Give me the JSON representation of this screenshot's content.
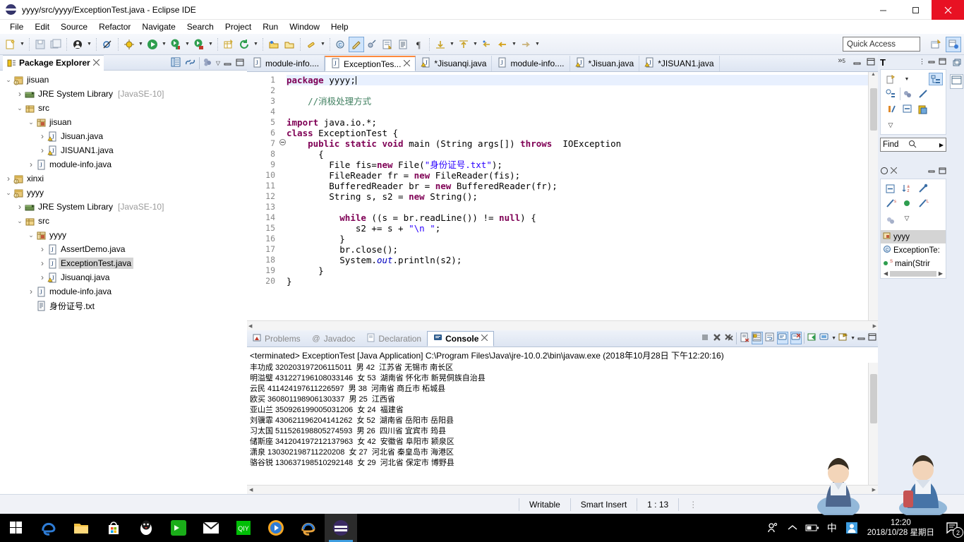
{
  "window": {
    "title": "yyyy/src/yyyy/ExceptionTest.java - Eclipse IDE",
    "app_icon": "eclipse-icon",
    "minimize": "minimize-icon",
    "maximize": "maximize-icon",
    "close": "close-icon"
  },
  "menu": [
    "File",
    "Edit",
    "Source",
    "Refactor",
    "Navigate",
    "Search",
    "Project",
    "Run",
    "Window",
    "Help"
  ],
  "toolbar": {
    "quick_access_placeholder": "Quick Access",
    "icons": [
      "new-wizard-icon",
      "save-icon",
      "save-all-icon",
      "profile-icon",
      "skip-breakpoints-icon",
      "debug-icon",
      "run-icon",
      "coverage-icon",
      "run-external-icon",
      "new-java-package-icon",
      "refresh-icon",
      "open-type-icon",
      "open-task-icon",
      "search-icon",
      "new-class-icon",
      "edit-icon",
      "annotate-icon",
      "open-editor-icon",
      "show-whitespace-icon",
      "pilcrow-icon",
      "next-annotation-icon",
      "previous-annotation-icon",
      "last-edit-icon",
      "back-icon",
      "forward-icon"
    ],
    "perspective_icons": [
      "open-perspective-icon",
      "java-perspective-icon"
    ]
  },
  "package_explorer": {
    "title": "Package Explorer",
    "close_icon": "close-view-icon",
    "toolbar_icons": [
      "collapse-all-icon",
      "link-with-editor-icon",
      "focus-on-active-task-icon",
      "view-menu-icon",
      "minimize-icon",
      "maximize-icon"
    ],
    "tree": [
      {
        "label": "jisuan",
        "indent": 0,
        "icon": "java-project-icon",
        "twisty": "open",
        "dim": false
      },
      {
        "label": "JRE System Library",
        "suffix": "[JavaSE-10]",
        "indent": 1,
        "icon": "library-icon",
        "twisty": "closed",
        "dim": false
      },
      {
        "label": "src",
        "indent": 1,
        "icon": "source-folder-icon",
        "twisty": "open",
        "dim": false
      },
      {
        "label": "jisuan",
        "indent": 2,
        "icon": "package-icon",
        "twisty": "open",
        "dim": false
      },
      {
        "label": "Jisuan.java",
        "indent": 3,
        "icon": "java-file-warning-icon",
        "twisty": "closed",
        "dim": false
      },
      {
        "label": "JISUAN1.java",
        "indent": 3,
        "icon": "java-file-warning-icon",
        "twisty": "closed",
        "dim": false
      },
      {
        "label": "module-info.java",
        "indent": 2,
        "icon": "java-file-icon",
        "twisty": "closed",
        "dim": false
      },
      {
        "label": "xinxi",
        "indent": 0,
        "icon": "java-project-icon",
        "twisty": "closed",
        "dim": false
      },
      {
        "label": "yyyy",
        "indent": 0,
        "icon": "java-project-icon",
        "twisty": "open",
        "dim": false
      },
      {
        "label": "JRE System Library",
        "suffix": "[JavaSE-10]",
        "indent": 1,
        "icon": "library-icon",
        "twisty": "closed",
        "dim": false
      },
      {
        "label": "src",
        "indent": 1,
        "icon": "source-folder-icon",
        "twisty": "open",
        "dim": false
      },
      {
        "label": "yyyy",
        "indent": 2,
        "icon": "package-icon",
        "twisty": "open",
        "dim": false
      },
      {
        "label": "AssertDemo.java",
        "indent": 3,
        "icon": "java-file-icon",
        "twisty": "closed",
        "dim": false
      },
      {
        "label": "ExceptionTest.java",
        "indent": 3,
        "icon": "java-file-icon",
        "twisty": "closed",
        "dim": false,
        "selected": true
      },
      {
        "label": "Jisuanqi.java",
        "indent": 3,
        "icon": "java-file-warning-icon",
        "twisty": "closed",
        "dim": false
      },
      {
        "label": "module-info.java",
        "indent": 2,
        "icon": "java-file-icon",
        "twisty": "closed",
        "dim": false
      },
      {
        "label": "身份证号.txt",
        "indent": 2,
        "icon": "text-file-icon",
        "twisty": "none",
        "dim": false
      }
    ]
  },
  "editor": {
    "tabs": [
      {
        "label": "module-info....",
        "active": false,
        "dirty": false,
        "icon": "java-file-icon"
      },
      {
        "label": "ExceptionTes...",
        "active": true,
        "dirty": false,
        "icon": "java-file-icon"
      },
      {
        "label": "*Jisuanqi.java",
        "active": false,
        "dirty": true,
        "icon": "java-file-warning-icon"
      },
      {
        "label": "module-info....",
        "active": false,
        "dirty": false,
        "icon": "java-file-icon"
      },
      {
        "label": "*Jisuan.java",
        "active": false,
        "dirty": true,
        "icon": "java-file-warning-icon"
      },
      {
        "label": "*JISUAN1.java",
        "active": false,
        "dirty": true,
        "icon": "java-file-warning-icon"
      }
    ],
    "more_tabs": "»",
    "more_tabs_count": "5",
    "lines": [
      {
        "n": 1,
        "fold": "",
        "highlight": true,
        "tokens": [
          {
            "t": "package ",
            "c": "kw"
          },
          {
            "t": "yyyy",
            "c": ""
          },
          {
            "t": ";",
            "c": ""
          },
          {
            "t": "|",
            "c": "cursor"
          }
        ]
      },
      {
        "n": 2,
        "fold": "",
        "tokens": []
      },
      {
        "n": 3,
        "fold": "",
        "tokens": [
          {
            "t": "    //消极处理方式",
            "c": "cmt"
          }
        ]
      },
      {
        "n": 4,
        "fold": "",
        "tokens": []
      },
      {
        "n": 5,
        "fold": "",
        "tokens": [
          {
            "t": "import ",
            "c": "kw"
          },
          {
            "t": "java.io.*;",
            "c": ""
          }
        ]
      },
      {
        "n": 6,
        "fold": "",
        "tokens": [
          {
            "t": "class ",
            "c": "kw"
          },
          {
            "t": "ExceptionTest {",
            "c": ""
          }
        ]
      },
      {
        "n": 7,
        "fold": "collapse",
        "tokens": [
          {
            "t": "    ",
            "c": ""
          },
          {
            "t": "public static void ",
            "c": "kw"
          },
          {
            "t": "main (String args[]) ",
            "c": ""
          },
          {
            "t": "throws ",
            "c": "kw"
          },
          {
            "t": " IOException",
            "c": ""
          }
        ]
      },
      {
        "n": 8,
        "fold": "",
        "tokens": [
          {
            "t": "      {",
            "c": ""
          }
        ]
      },
      {
        "n": 9,
        "fold": "",
        "tokens": [
          {
            "t": "        File fis=",
            "c": ""
          },
          {
            "t": "new ",
            "c": "kw"
          },
          {
            "t": "File(",
            "c": ""
          },
          {
            "t": "\"身份证号.txt\"",
            "c": "str"
          },
          {
            "t": ");",
            "c": ""
          }
        ]
      },
      {
        "n": 10,
        "fold": "",
        "tokens": [
          {
            "t": "        FileReader fr = ",
            "c": ""
          },
          {
            "t": "new ",
            "c": "kw"
          },
          {
            "t": "FileReader(fis);",
            "c": ""
          }
        ]
      },
      {
        "n": 11,
        "fold": "",
        "tokens": [
          {
            "t": "        BufferedReader br = ",
            "c": ""
          },
          {
            "t": "new ",
            "c": "kw"
          },
          {
            "t": "BufferedReader(fr);",
            "c": ""
          }
        ]
      },
      {
        "n": 12,
        "fold": "",
        "tokens": [
          {
            "t": "        String s, s2 = ",
            "c": ""
          },
          {
            "t": "new ",
            "c": "kw"
          },
          {
            "t": "String();",
            "c": ""
          }
        ]
      },
      {
        "n": 13,
        "fold": "",
        "tokens": []
      },
      {
        "n": 14,
        "fold": "",
        "tokens": [
          {
            "t": "          ",
            "c": ""
          },
          {
            "t": "while ",
            "c": "kw"
          },
          {
            "t": "((s = br.readLine()) != ",
            "c": ""
          },
          {
            "t": "null",
            "c": "kw"
          },
          {
            "t": ") {",
            "c": ""
          }
        ]
      },
      {
        "n": 15,
        "fold": "",
        "tokens": [
          {
            "t": "             s2 += s + ",
            "c": ""
          },
          {
            "t": "\"\\n \"",
            "c": "str"
          },
          {
            "t": ";",
            "c": ""
          }
        ]
      },
      {
        "n": 16,
        "fold": "",
        "tokens": [
          {
            "t": "          }",
            "c": ""
          }
        ]
      },
      {
        "n": 17,
        "fold": "",
        "tokens": [
          {
            "t": "          br.close();",
            "c": ""
          }
        ]
      },
      {
        "n": 18,
        "fold": "",
        "tokens": [
          {
            "t": "          System.",
            "c": ""
          },
          {
            "t": "out",
            "c": "fld"
          },
          {
            "t": ".println(s2);",
            "c": ""
          }
        ]
      },
      {
        "n": 19,
        "fold": "",
        "tokens": [
          {
            "t": "      }",
            "c": ""
          }
        ]
      },
      {
        "n": 20,
        "fold": "",
        "tokens": [
          {
            "t": "}",
            "c": ""
          }
        ]
      }
    ]
  },
  "bottom_panel": {
    "tabs": [
      {
        "label": "Problems",
        "icon": "problems-icon",
        "active": false
      },
      {
        "label": "Javadoc",
        "icon": "javadoc-icon",
        "active": false
      },
      {
        "label": "Declaration",
        "icon": "declaration-icon",
        "active": false
      },
      {
        "label": "Console",
        "icon": "console-icon",
        "active": true
      }
    ],
    "tab_close_icon": "close-view-icon",
    "toolbar_icons": [
      "terminate-icon",
      "remove-launch-icon",
      "remove-all-terminated-icon",
      "clear-console-icon",
      "scroll-lock-icon",
      "word-wrap-icon",
      "show-console-on-output-icon",
      "show-console-on-error-icon",
      "pin-console-icon",
      "display-selected-console-icon",
      "display-selected-console-arrow",
      "open-console-icon",
      "open-console-arrow",
      "minimize-icon",
      "maximize-icon"
    ],
    "console_header": "<terminated> ExceptionTest [Java Application] C:\\Program Files\\Java\\jre-10.0.2\\bin\\javaw.exe (2018年10月28日 下午12:20:16)",
    "console_lines": [
      "丰功成 320203197206115011  男 42  江苏省 无锡市 南长区",
      "明溢璧 431227196108033146  女 53  湖南省 怀化市 新晃侗族自治县",
      "云民 411424197611226597  男 38  河南省 商丘市 柘城县",
      "欧买 360801198906130337  男 25  江西省",
      "亚山兰 350926199005031206  女 24  福建省",
      "刘骥霏 430621196204141262  女 52  湖南省 岳阳市 岳阳县",
      "习太国 511526198805274593  男 26  四川省 宜宾市 筠县",
      "储斯座 341204197212137963  女 42  安徽省 阜阳市 颍泉区",
      "潇泉 130302198711220208  女 27  河北省 秦皇岛市 海港区",
      "骆谷锐 130637198510292148  女 29  河北省 保定市 博野县"
    ]
  },
  "right_panels": {
    "hierarchy": {
      "title_icon": "type-hierarchy-icon",
      "title": "T",
      "header_icons": [
        "view-menu-icon",
        "minimize-icon",
        "maximize-icon"
      ],
      "tool_icons": [
        "new-icon",
        "new-arrow",
        "type-hierarchy-mode-icon",
        "supertype-hierarchy-icon",
        "show-members-icon",
        "hide-fields-icon",
        "hide-static-icon",
        "hide-non-public-icon",
        "layout-icon",
        "view-menu-arrow"
      ],
      "find_label": "Find",
      "find_icon": "search-icon",
      "find_next_icon": "next-icon"
    },
    "outline": {
      "title_icon": "outline-icon",
      "close_icon": "close-view-icon",
      "header_icons": [
        "minimize-icon",
        "maximize-icon"
      ],
      "tool_icons": [
        "collapse-all-icon",
        "sort-icon",
        "hide-fields-icon",
        "hide-static-icon",
        "hide-public-icon",
        "hide-local-types-icon",
        "focus-icon",
        "view-menu-arrow"
      ],
      "items": [
        {
          "label": "yyyy",
          "icon": "package-icon",
          "selected": true
        },
        {
          "label": "ExceptionTe:",
          "icon": "class-icon",
          "selected": false
        },
        {
          "label": "main(Strir",
          "icon": "method-static-icon",
          "selected": false
        }
      ],
      "scroll_up_icon": "scroll-up-icon",
      "scroll_down_icon": "scroll-down-icon",
      "scroll_left_icon": "scroll-left-icon",
      "scroll_right_icon": "scroll-right-icon"
    },
    "fast_view_icons": [
      "restore-icon",
      "maximize-icon"
    ]
  },
  "status_bar": {
    "writable": "Writable",
    "insert_mode": "Smart Insert",
    "position": "1 : 13"
  },
  "taskbar": {
    "start_icon": "windows-start-icon",
    "apps": [
      "edge-icon",
      "file-explorer-icon",
      "microsoft-store-icon",
      "qq-icon",
      "wechat-icon",
      "mail-icon",
      "iqiyi-icon",
      "media-player-icon",
      "internet-explorer-icon",
      "eclipse-icon"
    ],
    "tray": [
      "people-icon",
      "show-hidden-icon",
      "battery-icon",
      "ime-chinese-icon",
      "user-icon"
    ],
    "clock_time": "12:20",
    "clock_date": "2018/10/28 星期日",
    "notification_icon": "notification-icon",
    "notification_count": "2"
  },
  "colors": {
    "accent": "#ff8a3d",
    "close_red": "#e81123",
    "keyword": "#7f0055",
    "string": "#2a00ff",
    "comment": "#3f7f5f",
    "field": "#0000c0",
    "selection": "#d4d4d4",
    "taskbar_bg": "#000000"
  }
}
